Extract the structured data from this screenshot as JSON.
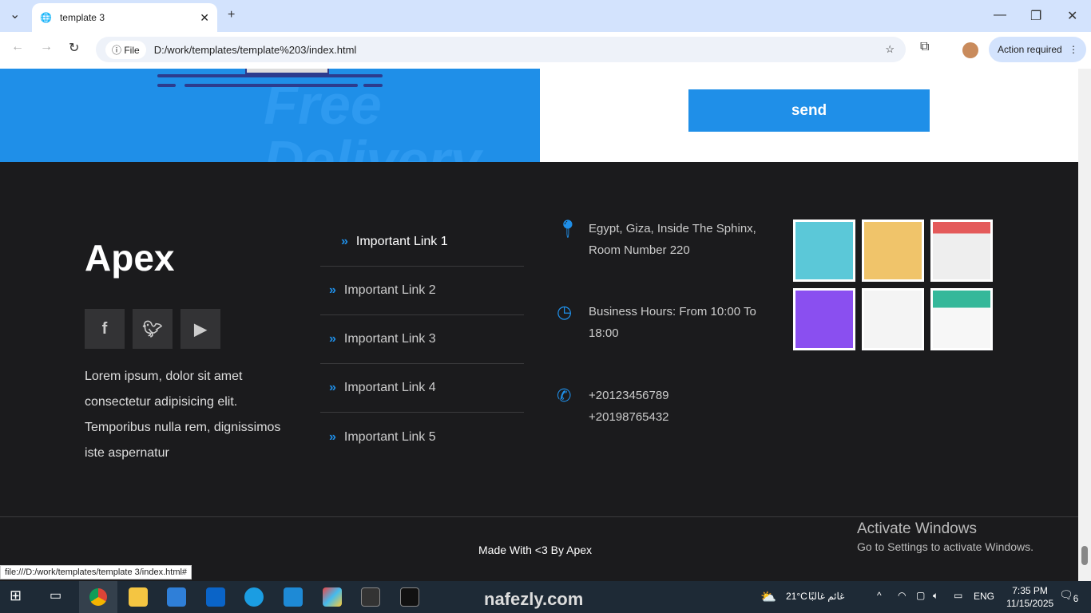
{
  "browser": {
    "tab_title": "template 3",
    "url_chip": "File",
    "url": "D:/work/templates/template%203/index.html",
    "action_required": "Action required",
    "status_url": "file:///D:/work/templates/template 3/index.html#"
  },
  "hero": {
    "ghost_text": "Free Delivery"
  },
  "form": {
    "send_label": "send"
  },
  "footer": {
    "logo": "Apex",
    "description": "Lorem ipsum, dolor sit amet consectetur adipisicing elit. Temporibus nulla rem, dignissimos iste aspernatur",
    "links": [
      "Important Link 1",
      "Important Link 2",
      "Important Link 3",
      "Important Link 4",
      "Important Link 5"
    ],
    "address": "Egypt, Giza, Inside The Sphinx, Room Number 220",
    "hours": "Business Hours: From 10:00 To 18:00",
    "phone1": "+20123456789",
    "phone2": "+20198765432",
    "copyright": "Made With <3 By Apex"
  },
  "overlay": {
    "activate_title": "Activate Windows",
    "activate_sub": "Go to Settings to activate Windows.",
    "watermark": "nafezly.com"
  },
  "taskbar": {
    "weather": "21°C",
    "weather_desc": "غائم غالبًا",
    "lang": "ENG",
    "time": "7:35 PM",
    "date": "11/15/2025",
    "notifications": "6"
  }
}
